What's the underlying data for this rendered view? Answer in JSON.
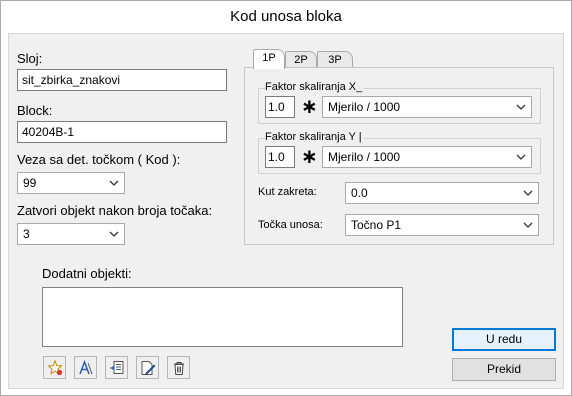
{
  "window": {
    "title": "Kod unosa bloka"
  },
  "left": {
    "sloj_label": "Sloj:",
    "sloj_value": "sit_zbirka_znakovi",
    "block_label": "Block:",
    "block_value": "40204B-1",
    "veza_label": "Veza sa det. točkom ( Kod ):",
    "veza_value": "99",
    "zatvori_label": "Zatvori objekt nakon broja točaka:",
    "zatvori_value": "3"
  },
  "tabs": [
    {
      "label": "1P",
      "active": true
    },
    {
      "label": "2P",
      "active": false
    },
    {
      "label": "3P",
      "active": false
    }
  ],
  "panel": {
    "scale_x_label": "Faktor skaliranja X_",
    "scale_x_value": "1.0",
    "scale_x_mult": "∗",
    "scale_x_unit": "Mjerilo / 1000",
    "scale_y_label": "Faktor skaliranja Y |",
    "scale_y_value": "1.0",
    "scale_y_mult": "∗",
    "scale_y_unit": "Mjerilo / 1000",
    "kut_label": "Kut zakreta:",
    "kut_value": "0.0",
    "tocka_label": "Točka unosa:",
    "tocka_value": "Točno P1"
  },
  "dodatni": {
    "label": "Dodatni objekti:"
  },
  "buttons": {
    "ok": "U redu",
    "cancel": "Prekid"
  },
  "icons": {
    "new": "new-object-star-icon",
    "text": "text-object-icon",
    "insert": "insert-list-icon",
    "edit": "edit-document-icon",
    "delete": "trash-icon"
  }
}
